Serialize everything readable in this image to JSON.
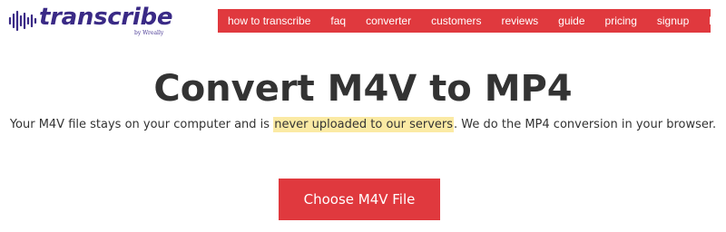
{
  "brand": {
    "name": "transcribe",
    "byline": "by Wreally",
    "color": "#3a2a86"
  },
  "nav": {
    "color": "#e0393e",
    "items": [
      "how to transcribe",
      "faq",
      "converter",
      "customers",
      "reviews",
      "guide",
      "pricing",
      "signup",
      "login"
    ]
  },
  "hero": {
    "title_pre": "Convert ",
    "title_from": "M4V",
    "title_mid": " to ",
    "title_to": "MP4",
    "subtitle_pre": "Your M4V file stays on your computer and is ",
    "subtitle_highlight": "never uploaded to our servers",
    "subtitle_post": ". We do the MP4 conversion in your browser.",
    "highlight_color": "#fbeaa4"
  },
  "cta": {
    "label": "Choose M4V File",
    "color": "#e0393e"
  },
  "icons": {
    "logo": "audio-waveform-icon"
  }
}
